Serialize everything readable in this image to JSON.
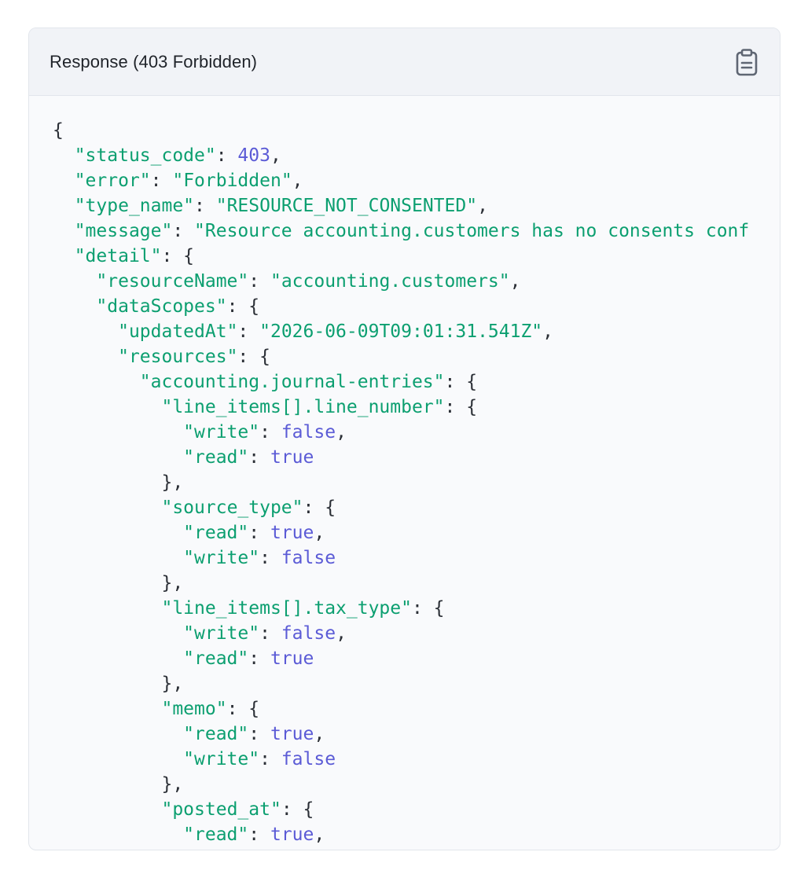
{
  "panel": {
    "title": "Response (403 Forbidden)",
    "copy_icon": "clipboard-icon"
  },
  "colors": {
    "key": "#0c9f70",
    "string": "#0c9f70",
    "number": "#5b5bd6",
    "boolean": "#5b5bd6",
    "punctuation": "#2b2f36"
  },
  "code_lines": [
    [
      {
        "t": "pun",
        "v": "{"
      }
    ],
    [
      {
        "t": "pun",
        "v": "  "
      },
      {
        "t": "key",
        "v": "\"status_code\""
      },
      {
        "t": "pun",
        "v": ": "
      },
      {
        "t": "num",
        "v": "403"
      },
      {
        "t": "pun",
        "v": ","
      }
    ],
    [
      {
        "t": "pun",
        "v": "  "
      },
      {
        "t": "key",
        "v": "\"error\""
      },
      {
        "t": "pun",
        "v": ": "
      },
      {
        "t": "str",
        "v": "\"Forbidden\""
      },
      {
        "t": "pun",
        "v": ","
      }
    ],
    [
      {
        "t": "pun",
        "v": "  "
      },
      {
        "t": "key",
        "v": "\"type_name\""
      },
      {
        "t": "pun",
        "v": ": "
      },
      {
        "t": "str",
        "v": "\"RESOURCE_NOT_CONSENTED\""
      },
      {
        "t": "pun",
        "v": ","
      }
    ],
    [
      {
        "t": "pun",
        "v": "  "
      },
      {
        "t": "key",
        "v": "\"message\""
      },
      {
        "t": "pun",
        "v": ": "
      },
      {
        "t": "str",
        "v": "\"Resource accounting.customers has no consents conf"
      }
    ],
    [
      {
        "t": "pun",
        "v": "  "
      },
      {
        "t": "key",
        "v": "\"detail\""
      },
      {
        "t": "pun",
        "v": ": {"
      }
    ],
    [
      {
        "t": "pun",
        "v": "    "
      },
      {
        "t": "key",
        "v": "\"resourceName\""
      },
      {
        "t": "pun",
        "v": ": "
      },
      {
        "t": "str",
        "v": "\"accounting.customers\""
      },
      {
        "t": "pun",
        "v": ","
      }
    ],
    [
      {
        "t": "pun",
        "v": "    "
      },
      {
        "t": "key",
        "v": "\"dataScopes\""
      },
      {
        "t": "pun",
        "v": ": {"
      }
    ],
    [
      {
        "t": "pun",
        "v": "      "
      },
      {
        "t": "key",
        "v": "\"updatedAt\""
      },
      {
        "t": "pun",
        "v": ": "
      },
      {
        "t": "str",
        "v": "\"2026-06-09T09:01:31.541Z\""
      },
      {
        "t": "pun",
        "v": ","
      }
    ],
    [
      {
        "t": "pun",
        "v": "      "
      },
      {
        "t": "key",
        "v": "\"resources\""
      },
      {
        "t": "pun",
        "v": ": {"
      }
    ],
    [
      {
        "t": "pun",
        "v": "        "
      },
      {
        "t": "key",
        "v": "\"accounting.journal-entries\""
      },
      {
        "t": "pun",
        "v": ": {"
      }
    ],
    [
      {
        "t": "pun",
        "v": "          "
      },
      {
        "t": "key",
        "v": "\"line_items[].line_number\""
      },
      {
        "t": "pun",
        "v": ": {"
      }
    ],
    [
      {
        "t": "pun",
        "v": "            "
      },
      {
        "t": "key",
        "v": "\"write\""
      },
      {
        "t": "pun",
        "v": ": "
      },
      {
        "t": "bool",
        "v": "false"
      },
      {
        "t": "pun",
        "v": ","
      }
    ],
    [
      {
        "t": "pun",
        "v": "            "
      },
      {
        "t": "key",
        "v": "\"read\""
      },
      {
        "t": "pun",
        "v": ": "
      },
      {
        "t": "bool",
        "v": "true"
      }
    ],
    [
      {
        "t": "pun",
        "v": "          },"
      }
    ],
    [
      {
        "t": "pun",
        "v": "          "
      },
      {
        "t": "key",
        "v": "\"source_type\""
      },
      {
        "t": "pun",
        "v": ": {"
      }
    ],
    [
      {
        "t": "pun",
        "v": "            "
      },
      {
        "t": "key",
        "v": "\"read\""
      },
      {
        "t": "pun",
        "v": ": "
      },
      {
        "t": "bool",
        "v": "true"
      },
      {
        "t": "pun",
        "v": ","
      }
    ],
    [
      {
        "t": "pun",
        "v": "            "
      },
      {
        "t": "key",
        "v": "\"write\""
      },
      {
        "t": "pun",
        "v": ": "
      },
      {
        "t": "bool",
        "v": "false"
      }
    ],
    [
      {
        "t": "pun",
        "v": "          },"
      }
    ],
    [
      {
        "t": "pun",
        "v": "          "
      },
      {
        "t": "key",
        "v": "\"line_items[].tax_type\""
      },
      {
        "t": "pun",
        "v": ": {"
      }
    ],
    [
      {
        "t": "pun",
        "v": "            "
      },
      {
        "t": "key",
        "v": "\"write\""
      },
      {
        "t": "pun",
        "v": ": "
      },
      {
        "t": "bool",
        "v": "false"
      },
      {
        "t": "pun",
        "v": ","
      }
    ],
    [
      {
        "t": "pun",
        "v": "            "
      },
      {
        "t": "key",
        "v": "\"read\""
      },
      {
        "t": "pun",
        "v": ": "
      },
      {
        "t": "bool",
        "v": "true"
      }
    ],
    [
      {
        "t": "pun",
        "v": "          },"
      }
    ],
    [
      {
        "t": "pun",
        "v": "          "
      },
      {
        "t": "key",
        "v": "\"memo\""
      },
      {
        "t": "pun",
        "v": ": {"
      }
    ],
    [
      {
        "t": "pun",
        "v": "            "
      },
      {
        "t": "key",
        "v": "\"read\""
      },
      {
        "t": "pun",
        "v": ": "
      },
      {
        "t": "bool",
        "v": "true"
      },
      {
        "t": "pun",
        "v": ","
      }
    ],
    [
      {
        "t": "pun",
        "v": "            "
      },
      {
        "t": "key",
        "v": "\"write\""
      },
      {
        "t": "pun",
        "v": ": "
      },
      {
        "t": "bool",
        "v": "false"
      }
    ],
    [
      {
        "t": "pun",
        "v": "          },"
      }
    ],
    [
      {
        "t": "pun",
        "v": "          "
      },
      {
        "t": "key",
        "v": "\"posted_at\""
      },
      {
        "t": "pun",
        "v": ": {"
      }
    ],
    [
      {
        "t": "pun",
        "v": "            "
      },
      {
        "t": "key",
        "v": "\"read\""
      },
      {
        "t": "pun",
        "v": ": "
      },
      {
        "t": "bool",
        "v": "true"
      },
      {
        "t": "pun",
        "v": ","
      }
    ]
  ]
}
